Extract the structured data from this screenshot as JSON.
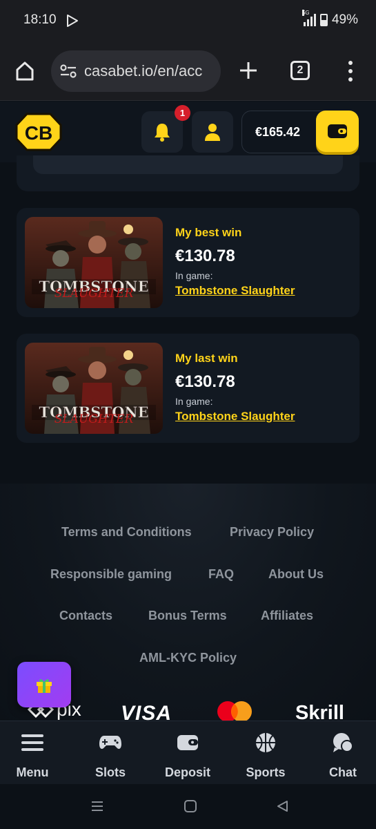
{
  "status": {
    "time": "18:10",
    "network": "5G",
    "battery": "49%"
  },
  "browser": {
    "url": "casabet.io/en/acc",
    "tab_count": "2"
  },
  "header": {
    "logo_text": "CB",
    "notification_count": "1",
    "balance": "€165.42",
    "accent": "#ffd319"
  },
  "wins": [
    {
      "label": "My best win",
      "amount": "€130.78",
      "in_game_label": "In game:",
      "game": "Tombstone Slaughter"
    },
    {
      "label": "My last win",
      "amount": "€130.78",
      "in_game_label": "In game:",
      "game": "Tombstone Slaughter"
    }
  ],
  "footer": {
    "links": [
      "Terms and Conditions",
      "Privacy Policy",
      "Responsible gaming",
      "FAQ",
      "About Us",
      "Contacts",
      "Bonus Terms",
      "Affiliates",
      "AML-KYC Policy"
    ],
    "payments": [
      "pix",
      "VISA",
      "mastercard",
      "Skrill"
    ]
  },
  "bottom_nav": [
    {
      "label": "Menu",
      "icon": "menu-icon"
    },
    {
      "label": "Slots",
      "icon": "gamepad-icon"
    },
    {
      "label": "Deposit",
      "icon": "wallet-icon"
    },
    {
      "label": "Sports",
      "icon": "basketball-icon"
    },
    {
      "label": "Chat",
      "icon": "chat-icon"
    }
  ]
}
